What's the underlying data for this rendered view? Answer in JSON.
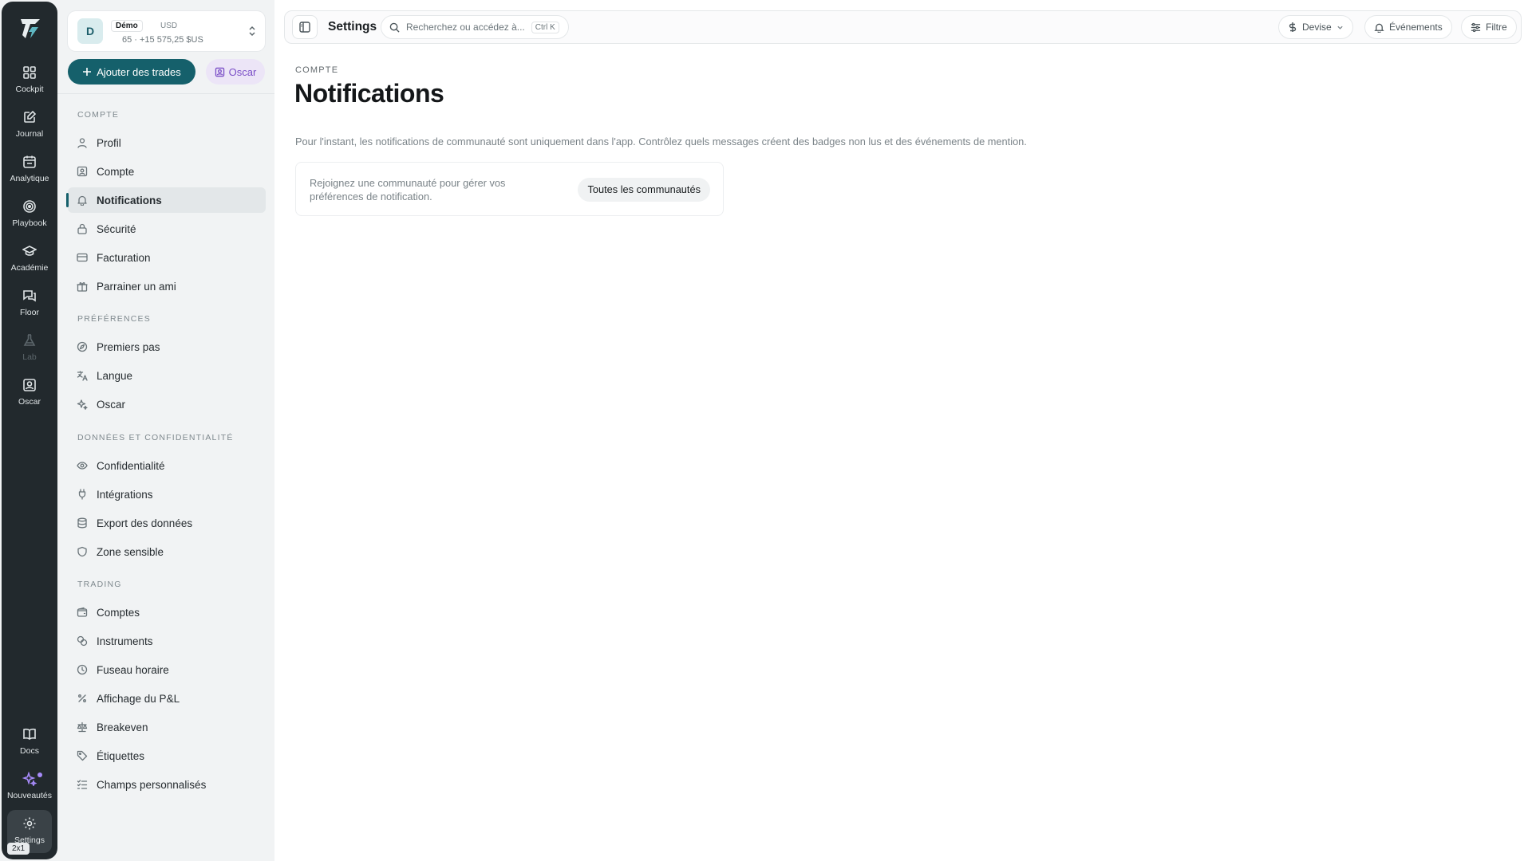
{
  "rail": {
    "items": [
      {
        "label": "Cockpit",
        "icon": "grid-icon"
      },
      {
        "label": "Journal",
        "icon": "edit-note-icon"
      },
      {
        "label": "Analytique",
        "icon": "calendar-icon"
      },
      {
        "label": "Playbook",
        "icon": "target-icon"
      },
      {
        "label": "Académie",
        "icon": "graduation-cap-icon"
      },
      {
        "label": "Floor",
        "icon": "chat-bubbles-icon"
      },
      {
        "label": "Lab",
        "icon": "flask-icon"
      },
      {
        "label": "Oscar",
        "icon": "portrait-icon"
      }
    ],
    "bottom": [
      {
        "label": "Docs",
        "icon": "book-icon"
      },
      {
        "label": "Nouveautés",
        "icon": "sparkles-icon"
      },
      {
        "label": "Settings",
        "icon": "gear-icon"
      }
    ],
    "zoom_chip": "2x1"
  },
  "account": {
    "avatar": "D",
    "mode": "Démo",
    "currency": "USD",
    "balance": "65 · +15 575,25 $US"
  },
  "actions": {
    "add_trades": "Ajouter des trades",
    "oscar": "Oscar"
  },
  "sidebar": {
    "sections": [
      {
        "title": "Compte",
        "items": [
          "Profil",
          "Compte",
          "Notifications",
          "Sécurité",
          "Facturation",
          "Parrainer un ami"
        ]
      },
      {
        "title": "Préférences",
        "items": [
          "Premiers pas",
          "Langue",
          "Oscar"
        ]
      },
      {
        "title": "Données et confidentialité",
        "items": [
          "Confidentialité",
          "Intégrations",
          "Export des données",
          "Zone sensible"
        ]
      },
      {
        "title": "Trading",
        "items": [
          "Comptes",
          "Instruments",
          "Fuseau horaire",
          "Affichage du P&L",
          "Breakeven",
          "Étiquettes",
          "Champs personnalisés"
        ]
      }
    ],
    "selected": "Notifications"
  },
  "topbar": {
    "title": "Settings",
    "search_placeholder": "Recherchez ou accédez à...",
    "shortcut": "Ctrl K",
    "devise": "Devise",
    "events": "Événements",
    "filter": "Filtre"
  },
  "content": {
    "breadcrumb": "Compte",
    "title": "Notifications",
    "description": "Pour l'instant, les notifications de communauté sont uniquement dans l'app. Contrôlez quels messages créent des badges non lus et des événements de mention.",
    "card_text": "Rejoignez une communauté pour gérer vos préférences de notification.",
    "card_button": "Toutes les communautés"
  },
  "colors": {
    "accent": "#15606b",
    "rail": "#22292d",
    "oscar": "#7a4ec7"
  }
}
